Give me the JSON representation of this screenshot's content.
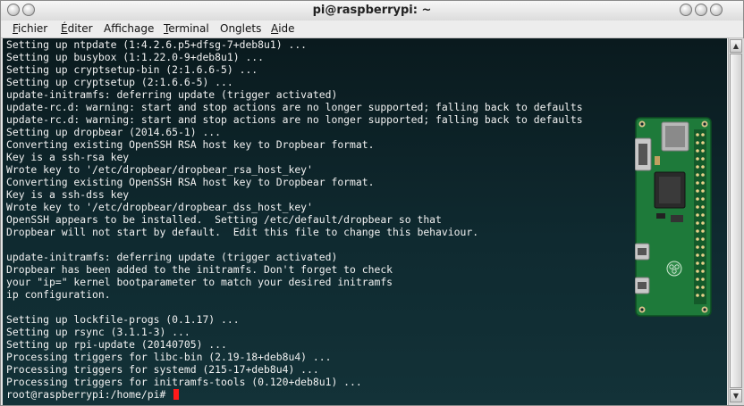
{
  "window": {
    "title": "pi@raspberrypi: ~"
  },
  "menu": [
    {
      "label": "Fichier",
      "mnemonic": "F",
      "rest": "ichier"
    },
    {
      "label": "Éditer",
      "mnemonic": "É",
      "rest": "diter"
    },
    {
      "label": "Affichage",
      "mnemonic": "",
      "rest": "Affichage"
    },
    {
      "label": "Terminal",
      "mnemonic": "T",
      "rest": "erminal"
    },
    {
      "label": "Onglets",
      "mnemonic": "",
      "rest": "Onglets"
    },
    {
      "label": "Aide",
      "mnemonic": "A",
      "rest": "ide"
    }
  ],
  "terminal": {
    "lines": [
      "Setting up ntpdate (1:4.2.6.p5+dfsg-7+deb8u1) ...",
      "Setting up busybox (1:1.22.0-9+deb8u1) ...",
      "Setting up cryptsetup-bin (2:1.6.6-5) ...",
      "Setting up cryptsetup (2:1.6.6-5) ...",
      "update-initramfs: deferring update (trigger activated)",
      "update-rc.d: warning: start and stop actions are no longer supported; falling back to defaults",
      "update-rc.d: warning: start and stop actions are no longer supported; falling back to defaults",
      "Setting up dropbear (2014.65-1) ...",
      "Converting existing OpenSSH RSA host key to Dropbear format.",
      "Key is a ssh-rsa key",
      "Wrote key to '/etc/dropbear/dropbear_rsa_host_key'",
      "Converting existing OpenSSH RSA host key to Dropbear format.",
      "Key is a ssh-dss key",
      "Wrote key to '/etc/dropbear/dropbear_dss_host_key'",
      "OpenSSH appears to be installed.  Setting /etc/default/dropbear so that",
      "Dropbear will not start by default.  Edit this file to change this behaviour.",
      "",
      "update-initramfs: deferring update (trigger activated)",
      "Dropbear has been added to the initramfs. Don't forget to check",
      "your \"ip=\" kernel bootparameter to match your desired initramfs",
      "ip configuration.",
      "",
      "Setting up lockfile-progs (0.1.17) ...",
      "Setting up rsync (3.1.1-3) ...",
      "Setting up rpi-update (20140705) ...",
      "Processing triggers for libc-bin (2.19-18+deb8u4) ...",
      "Processing triggers for systemd (215-17+deb8u4) ...",
      "Processing triggers for initramfs-tools (0.120+deb8u1) ..."
    ],
    "prompt": "root@raspberrypi:/home/pi# ",
    "cursor_color": "#ff1a1a"
  },
  "colors": {
    "terminal_bg": "#0f2a30",
    "terminal_fg": "#f2f2f2"
  },
  "icons": {
    "left_buttons": [
      "window-menu-icon",
      "sticky-icon"
    ],
    "right_buttons": [
      "minimize-icon",
      "maximize-icon",
      "close-icon"
    ]
  }
}
